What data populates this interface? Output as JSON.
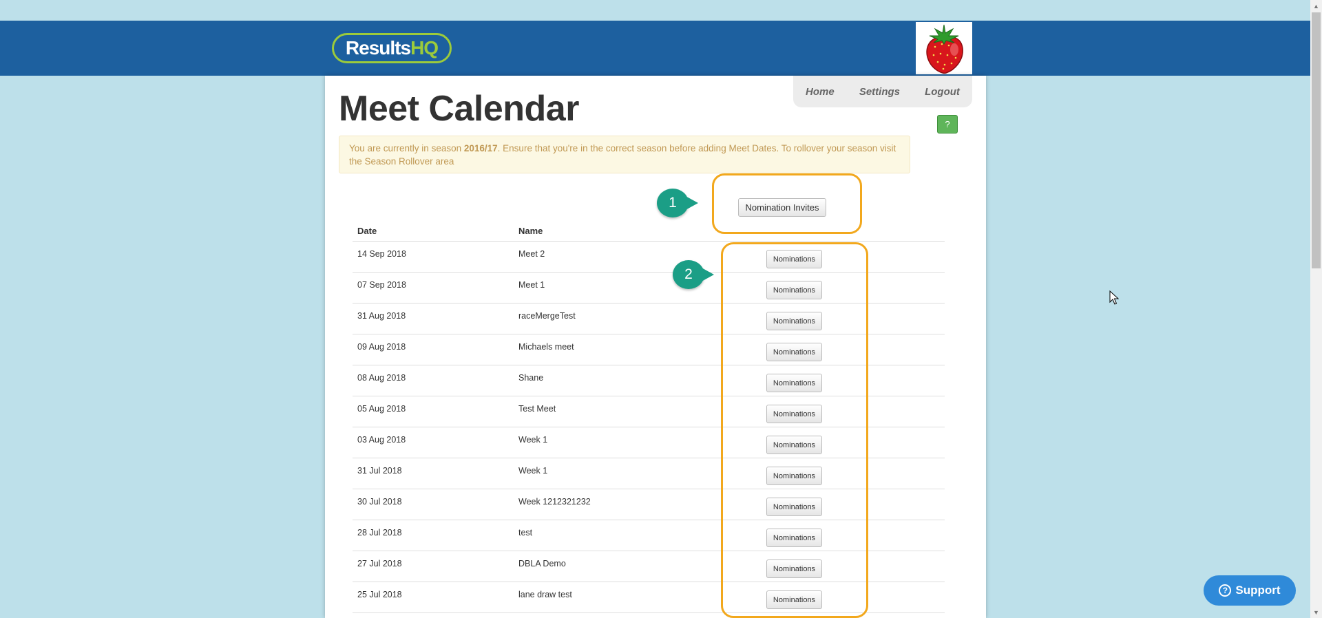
{
  "header": {
    "logo_white": "Results",
    "logo_green": "HQ"
  },
  "nav": {
    "home": "Home",
    "settings": "Settings",
    "logout": "Logout"
  },
  "page": {
    "title": "Meet Calendar",
    "help_label": "?"
  },
  "notice": {
    "prefix": "You are currently in season ",
    "season": "2016/17",
    "suffix": ". Ensure that you're in the correct season before adding Meet Dates. To rollover your season visit the Season Rollover area"
  },
  "actions": {
    "nomination_invites": "Nomination Invites"
  },
  "table": {
    "headers": {
      "date": "Date",
      "name": "Name"
    },
    "button_label": "Nominations",
    "rows": [
      {
        "date": "14 Sep 2018",
        "name": "Meet 2"
      },
      {
        "date": "07 Sep 2018",
        "name": "Meet 1"
      },
      {
        "date": "31 Aug 2018",
        "name": "raceMergeTest"
      },
      {
        "date": "09 Aug 2018",
        "name": "Michaels meet"
      },
      {
        "date": "08 Aug 2018",
        "name": "Shane"
      },
      {
        "date": "05 Aug 2018",
        "name": "Test Meet"
      },
      {
        "date": "03 Aug 2018",
        "name": "Week 1"
      },
      {
        "date": "31 Jul 2018",
        "name": "Week 1"
      },
      {
        "date": "30 Jul 2018",
        "name": "Week 1212321232"
      },
      {
        "date": "28 Jul 2018",
        "name": "test"
      },
      {
        "date": "27 Jul 2018",
        "name": "DBLA Demo"
      },
      {
        "date": "25 Jul 2018",
        "name": "lane draw test"
      }
    ]
  },
  "markers": {
    "one": "1",
    "two": "2"
  },
  "support": {
    "label": "Support",
    "icon_glyph": "?"
  },
  "colors": {
    "header": "#1d609f",
    "background": "#bde0ea",
    "accent_green": "#9ccb3b",
    "callout": "#f2a81d",
    "marker": "#1b9e86",
    "support": "#2f8ad9"
  },
  "icons": [
    "strawberry-avatar-icon",
    "help-icon",
    "mouse-cursor-icon",
    "support-question-icon"
  ]
}
